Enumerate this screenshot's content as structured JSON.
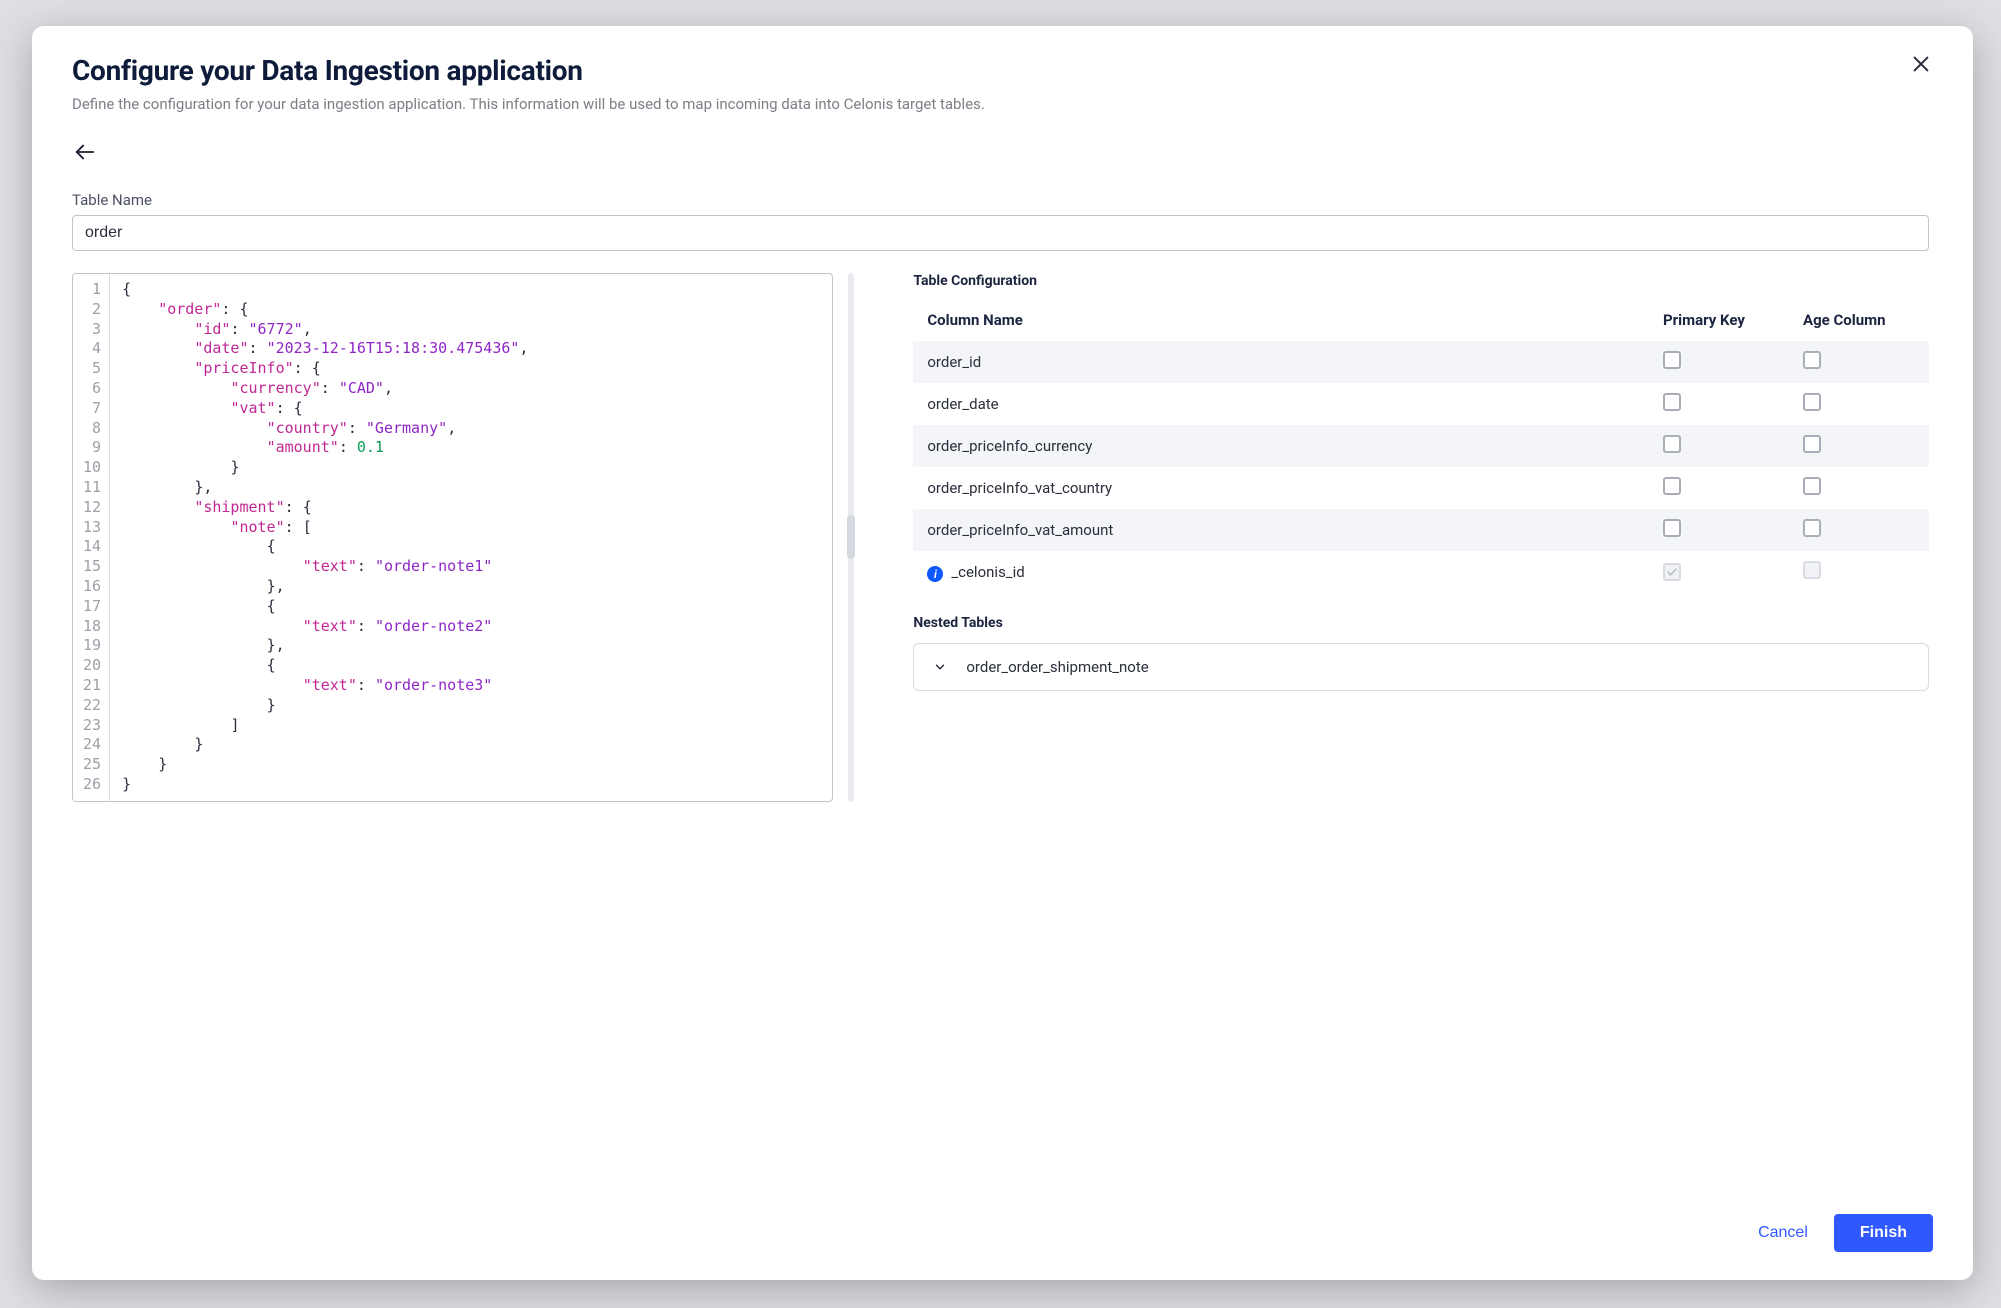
{
  "modal": {
    "title": "Configure your Data Ingestion application",
    "subtitle": "Define the configuration for your data ingestion application. This information will be used to map incoming data into Celonis target tables."
  },
  "form": {
    "table_name_label": "Table Name",
    "table_name_value": "order"
  },
  "code": {
    "line_count": 26,
    "tokens": [
      [
        {
          "t": "punct",
          "v": "{"
        }
      ],
      [
        {
          "t": "indent",
          "v": "    "
        },
        {
          "t": "key",
          "v": "\"order\""
        },
        {
          "t": "colon",
          "v": ": "
        },
        {
          "t": "punct",
          "v": "{"
        }
      ],
      [
        {
          "t": "indent",
          "v": "        "
        },
        {
          "t": "key",
          "v": "\"id\""
        },
        {
          "t": "colon",
          "v": ": "
        },
        {
          "t": "str",
          "v": "\"6772\""
        },
        {
          "t": "punct",
          "v": ","
        }
      ],
      [
        {
          "t": "indent",
          "v": "        "
        },
        {
          "t": "key",
          "v": "\"date\""
        },
        {
          "t": "colon",
          "v": ": "
        },
        {
          "t": "str",
          "v": "\"2023-12-16T15:18:30.475436\""
        },
        {
          "t": "punct",
          "v": ","
        }
      ],
      [
        {
          "t": "indent",
          "v": "        "
        },
        {
          "t": "key",
          "v": "\"priceInfo\""
        },
        {
          "t": "colon",
          "v": ": "
        },
        {
          "t": "punct",
          "v": "{"
        }
      ],
      [
        {
          "t": "indent",
          "v": "            "
        },
        {
          "t": "key",
          "v": "\"currency\""
        },
        {
          "t": "colon",
          "v": ": "
        },
        {
          "t": "str",
          "v": "\"CAD\""
        },
        {
          "t": "punct",
          "v": ","
        }
      ],
      [
        {
          "t": "indent",
          "v": "            "
        },
        {
          "t": "key",
          "v": "\"vat\""
        },
        {
          "t": "colon",
          "v": ": "
        },
        {
          "t": "punct",
          "v": "{"
        }
      ],
      [
        {
          "t": "indent",
          "v": "                "
        },
        {
          "t": "key",
          "v": "\"country\""
        },
        {
          "t": "colon",
          "v": ": "
        },
        {
          "t": "str",
          "v": "\"Germany\""
        },
        {
          "t": "punct",
          "v": ","
        }
      ],
      [
        {
          "t": "indent",
          "v": "                "
        },
        {
          "t": "key",
          "v": "\"amount\""
        },
        {
          "t": "colon",
          "v": ": "
        },
        {
          "t": "num",
          "v": "0.1"
        }
      ],
      [
        {
          "t": "indent",
          "v": "            "
        },
        {
          "t": "punct",
          "v": "}"
        }
      ],
      [
        {
          "t": "indent",
          "v": "        "
        },
        {
          "t": "punct",
          "v": "},"
        }
      ],
      [
        {
          "t": "indent",
          "v": "        "
        },
        {
          "t": "key",
          "v": "\"shipment\""
        },
        {
          "t": "colon",
          "v": ": "
        },
        {
          "t": "punct",
          "v": "{"
        }
      ],
      [
        {
          "t": "indent",
          "v": "            "
        },
        {
          "t": "key",
          "v": "\"note\""
        },
        {
          "t": "colon",
          "v": ": "
        },
        {
          "t": "punct",
          "v": "["
        }
      ],
      [
        {
          "t": "indent",
          "v": "                "
        },
        {
          "t": "punct",
          "v": "{"
        }
      ],
      [
        {
          "t": "indent",
          "v": "                    "
        },
        {
          "t": "key",
          "v": "\"text\""
        },
        {
          "t": "colon",
          "v": ": "
        },
        {
          "t": "str",
          "v": "\"order-note1\""
        }
      ],
      [
        {
          "t": "indent",
          "v": "                "
        },
        {
          "t": "punct",
          "v": "},"
        }
      ],
      [
        {
          "t": "indent",
          "v": "                "
        },
        {
          "t": "punct",
          "v": "{"
        }
      ],
      [
        {
          "t": "indent",
          "v": "                    "
        },
        {
          "t": "key",
          "v": "\"text\""
        },
        {
          "t": "colon",
          "v": ": "
        },
        {
          "t": "str",
          "v": "\"order-note2\""
        }
      ],
      [
        {
          "t": "indent",
          "v": "                "
        },
        {
          "t": "punct",
          "v": "},"
        }
      ],
      [
        {
          "t": "indent",
          "v": "                "
        },
        {
          "t": "punct",
          "v": "{"
        }
      ],
      [
        {
          "t": "indent",
          "v": "                    "
        },
        {
          "t": "key",
          "v": "\"text\""
        },
        {
          "t": "colon",
          "v": ": "
        },
        {
          "t": "str",
          "v": "\"order-note3\""
        }
      ],
      [
        {
          "t": "indent",
          "v": "                "
        },
        {
          "t": "punct",
          "v": "}"
        }
      ],
      [
        {
          "t": "indent",
          "v": "            "
        },
        {
          "t": "punct",
          "v": "]"
        }
      ],
      [
        {
          "t": "indent",
          "v": "        "
        },
        {
          "t": "punct",
          "v": "}"
        }
      ],
      [
        {
          "t": "indent",
          "v": "    "
        },
        {
          "t": "punct",
          "v": "}"
        }
      ],
      [
        {
          "t": "punct",
          "v": "}"
        }
      ]
    ]
  },
  "table_config": {
    "heading": "Table Configuration",
    "columns": {
      "name": "Column Name",
      "pk": "Primary Key",
      "age": "Age Column"
    },
    "rows": [
      {
        "name": "order_id",
        "pk": false,
        "age": false,
        "info": false,
        "disabled": false
      },
      {
        "name": "order_date",
        "pk": false,
        "age": false,
        "info": false,
        "disabled": false
      },
      {
        "name": "order_priceInfo_currency",
        "pk": false,
        "age": false,
        "info": false,
        "disabled": false
      },
      {
        "name": "order_priceInfo_vat_country",
        "pk": false,
        "age": false,
        "info": false,
        "disabled": false
      },
      {
        "name": "order_priceInfo_vat_amount",
        "pk": false,
        "age": false,
        "info": false,
        "disabled": false
      },
      {
        "name": "_celonis_id",
        "pk": true,
        "age": false,
        "info": true,
        "disabled": true
      }
    ]
  },
  "nested": {
    "heading": "Nested Tables",
    "items": [
      {
        "name": "order_order_shipment_note"
      }
    ]
  },
  "footer": {
    "cancel": "Cancel",
    "finish": "Finish"
  }
}
